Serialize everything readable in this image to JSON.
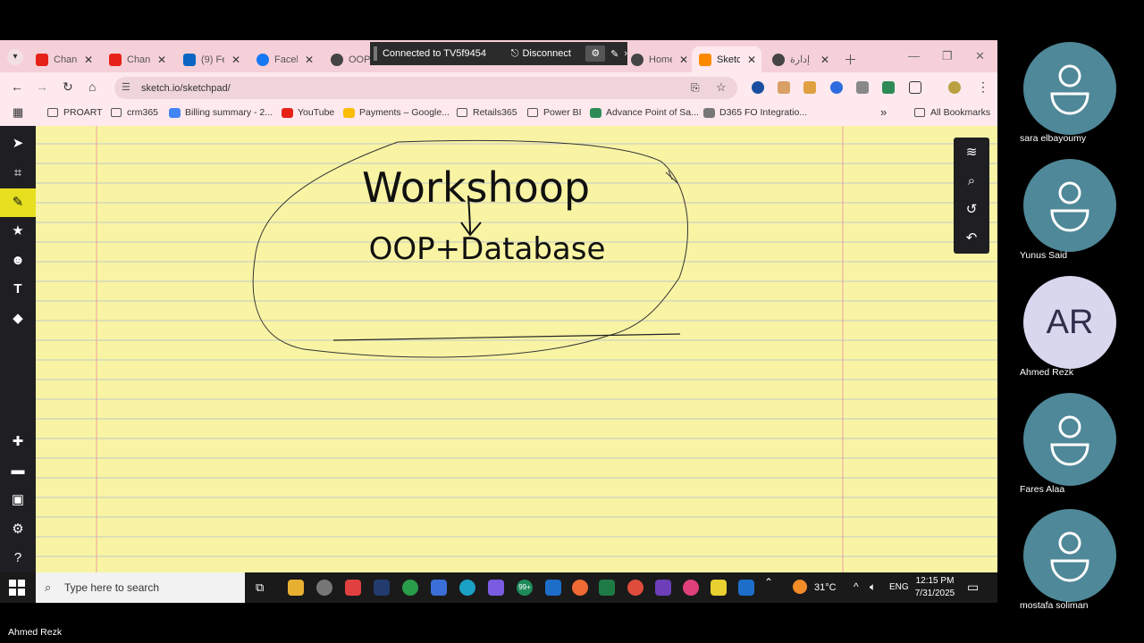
{
  "browser": {
    "tabs": [
      {
        "label": "Chan",
        "color": "#e62117"
      },
      {
        "label": "Chan",
        "color": "#e62117"
      },
      {
        "label": "(9) Fe",
        "color": "#0a66c2"
      },
      {
        "label": "Faceb",
        "color": "#1877f2"
      },
      {
        "label": "OOP",
        "color": "#444444"
      },
      {
        "label": "Home",
        "color": "#444444"
      },
      {
        "label": "Sketc",
        "color": "#ff8a00"
      },
      {
        "label": "إدارة",
        "color": "#444444"
      }
    ],
    "teamviewer": {
      "status": "Connected to TV5f9454",
      "disconnect": "Disconnect"
    },
    "url": "sketch.io/sketchpad/",
    "bookmarks": [
      {
        "label": "PROART",
        "kind": "folder"
      },
      {
        "label": "crm365",
        "kind": "folder"
      },
      {
        "label": "Billing summary - 2...",
        "kind": "site",
        "color": "#4285f4"
      },
      {
        "label": "YouTube",
        "kind": "site",
        "color": "#e62117"
      },
      {
        "label": "Payments – Google...",
        "kind": "site",
        "color": "#fbbc05"
      },
      {
        "label": "Retails365",
        "kind": "folder"
      },
      {
        "label": "Power BI",
        "kind": "folder"
      },
      {
        "label": "Advance Point of Sa...",
        "kind": "site",
        "color": "#2e8b57"
      },
      {
        "label": "D365 FO Integratio...",
        "kind": "site",
        "color": "#777777"
      }
    ],
    "bookmarks_more": "»",
    "all_bookmarks": "All Bookmarks"
  },
  "sketch": {
    "title": "Workshoop",
    "subtitle": "OOP+Database"
  },
  "taskbar": {
    "search_placeholder": "Type here to search",
    "temperature": "31°C",
    "language": "ENG",
    "time": "12:15 PM",
    "date": "7/31/2025",
    "badge": "99+"
  },
  "participants": [
    {
      "name": "sara elbayoumy",
      "initials": ""
    },
    {
      "name": "Yunus Said",
      "initials": ""
    },
    {
      "name": "Ahmed Rezk",
      "initials": "AR"
    },
    {
      "name": "Fares Alaa",
      "initials": ""
    },
    {
      "name": "mostafa soliman",
      "initials": ""
    }
  ],
  "presenter": "Ahmed Rezk",
  "colors": {
    "tab_strip": "#f6d0d8",
    "canvas_paper": "#f9f4a4",
    "avatar_teal": "#4f8898",
    "avatar_lavender": "#d9d7ee"
  }
}
